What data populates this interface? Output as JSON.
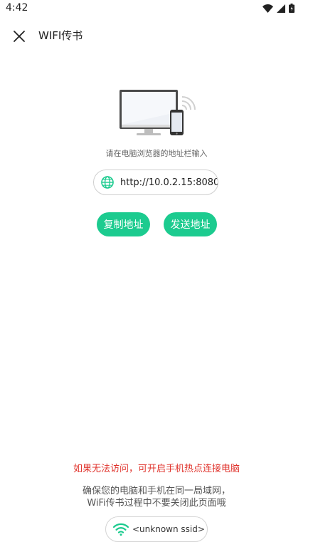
{
  "status_bar": {
    "time": "4:42"
  },
  "app_bar": {
    "title": "WIFI传书"
  },
  "main": {
    "hint": "请在电脑浏览器的地址栏输入",
    "address": "http://10.0.2.15:8080",
    "copy_label": "复制地址",
    "send_label": "发送地址"
  },
  "footer": {
    "warning": "如果无法访问，可开启手机热点连接电脑",
    "info_line1": "确保您的电脑和手机在同一局域网，",
    "info_line2": "WiFi传书过程中不要关闭此页面哦",
    "ssid": "<unknown ssid>"
  },
  "colors": {
    "accent": "#1ccb8f",
    "warning": "#e0332c"
  },
  "icons": {
    "close": "close-icon",
    "globe": "globe-icon",
    "wifi": "wifi-icon"
  }
}
